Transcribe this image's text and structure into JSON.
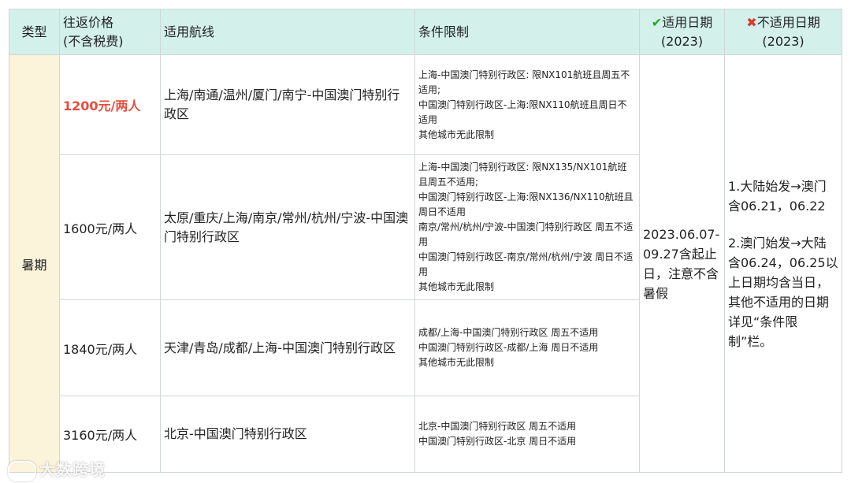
{
  "header": {
    "type": "类型",
    "price_line1": "往返价格",
    "price_line2": "(不含税费)",
    "route": "适用航线",
    "conditions": "条件限制",
    "applicable_label": "适用日期",
    "applicable_year": "(2023)",
    "not_applicable_label": "不适用日期",
    "not_applicable_year": "(2023)"
  },
  "type_value": "暑期",
  "rows": [
    {
      "price": "1200元/两人",
      "route": "上海/南通/温州/厦门/南宁-中国澳门特别行政区",
      "conditions": [
        "上海-中国澳门特别行政区: 限NX101航班且周五不适用;",
        "中国澳门特别行政区-上海:限NX110航班且周日不适用",
        "其他城市无此限制"
      ]
    },
    {
      "price": "1600元/两人",
      "route": "太原/重庆/上海/南京/常州/杭州/宁波-中国澳门特别行政区",
      "conditions": [
        "上海-中国澳门特别行政区: 限NX135/NX101航班且周五不适用;",
        "中国澳门特别行政区-上海:限NX136/NX110航班且周日不适用",
        "南京/常州/杭州/宁波-中国澳门特别行政区 周五不适用",
        "中国澳门特别行政区-南京/常州/杭州/宁波 周日不适用",
        "其他城市无此限制"
      ]
    },
    {
      "price": "1840元/两人",
      "route": "天津/青岛/成都/上海-中国澳门特别行政区",
      "conditions": [
        "成都/上海-中国澳门特别行政区 周五不适用",
        "中国澳门特别行政区-成都/上海 周日不适用",
        "其他城市无此限制"
      ]
    },
    {
      "price": "3160元/两人",
      "route": "北京-中国澳门特别行政区",
      "conditions": [
        "北京-中国澳门特别行政区 周五不适用",
        "中国澳门特别行政区-北京 周日不适用"
      ]
    }
  ],
  "applicable_dates": "2023.06.07-09.27含起止日，注意不含暑假",
  "not_applicable": {
    "part1": "1.大陆始发→澳门含06.21，06.22",
    "part2": "2.澳门始发→大陆含06.24，06.25以上日期均含当日，其他不适用的日期详见“条件限制”栏。"
  },
  "watermark": "大数跨境",
  "colors": {
    "header_bg": "#d3f0eb",
    "type_bg": "#fbf3da",
    "highlight_price": "#e84d3d",
    "check": "#2aa52a",
    "cross": "#d83b2e"
  }
}
